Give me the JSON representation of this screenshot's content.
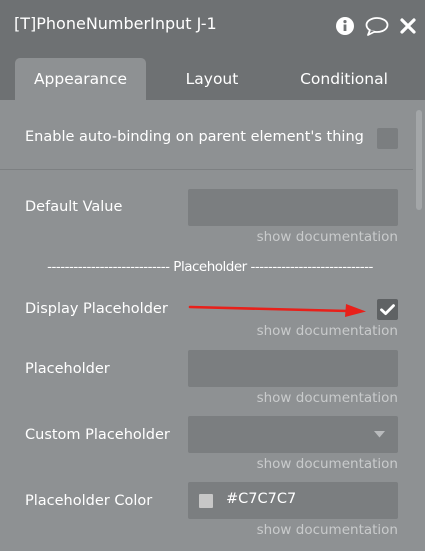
{
  "window": {
    "title": "[T]PhoneNumberInput J-1"
  },
  "tabs": [
    {
      "label": "Appearance",
      "active": true
    },
    {
      "label": "Layout",
      "active": false
    },
    {
      "label": "Conditional",
      "active": false
    }
  ],
  "fields": {
    "auto_binding": {
      "label": "Enable auto-binding on parent element's thing",
      "checked": false
    },
    "default_value": {
      "label": "Default Value",
      "value": "",
      "doc": "show documentation"
    },
    "placeholder_section": {
      "label": "---------------------------- Placeholder ----------------------------"
    },
    "display_placeholder": {
      "label": "Display Placeholder",
      "checked": true,
      "doc": "show documentation"
    },
    "placeholder": {
      "label": "Placeholder",
      "value": "",
      "doc": "show documentation"
    },
    "custom_placeholder": {
      "label": "Custom Placeholder",
      "value": "",
      "doc": "show documentation"
    },
    "placeholder_color": {
      "label": "Placeholder Color",
      "value": "#C7C7C7",
      "swatch": "#C7C7C7",
      "doc": "show documentation"
    }
  },
  "colors": {
    "panel_bg": "#6e7173",
    "content_bg": "#8e9193",
    "input_bg": "#7b7e80",
    "annotation_arrow": "#e8201a"
  },
  "icons": [
    "info-icon",
    "comment-icon",
    "close-icon",
    "checkmark-icon",
    "dropdown-caret-icon"
  ]
}
